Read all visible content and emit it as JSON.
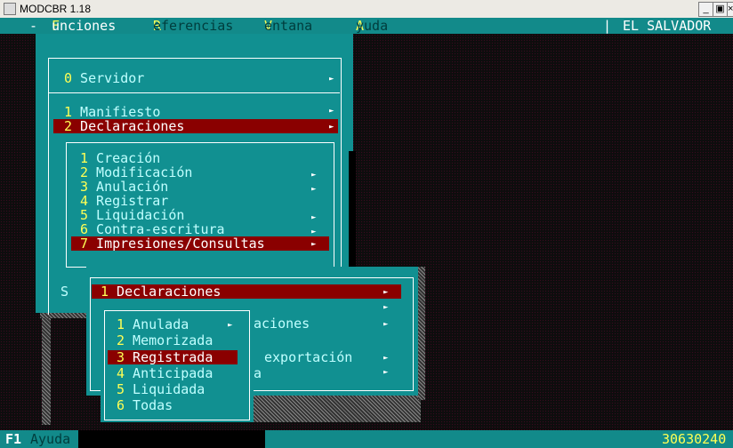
{
  "window": {
    "title": "MODCBR 1.18",
    "controls": [
      "_",
      "×"
    ]
  },
  "menubar": {
    "dash": "-",
    "items": [
      {
        "hot": "F",
        "rest": "unciones"
      },
      {
        "hot": "R",
        "rest": "eferencias"
      },
      {
        "hot": "V",
        "rest": "entana"
      },
      {
        "hot": "A",
        "rest": "yuda"
      }
    ],
    "country": "EL SALVADOR",
    "separator": "|"
  },
  "menu1": {
    "items": [
      {
        "num": "0",
        "label": " Servidor",
        "arrow": "►"
      },
      {
        "num": "1",
        "label": " Manifiesto",
        "arrow": "►"
      },
      {
        "num": "2",
        "label": " Declaraciones",
        "arrow": "►"
      }
    ],
    "partial_label": "S"
  },
  "menu2": {
    "items": [
      {
        "num": "1",
        "label": " Creación",
        "arrow": ""
      },
      {
        "num": "2",
        "label": " Modificación",
        "arrow": "►"
      },
      {
        "num": "3",
        "label": " Anulación",
        "arrow": "►"
      },
      {
        "num": "4",
        "label": " Registrar",
        "arrow": ""
      },
      {
        "num": "5",
        "label": " Liquidación",
        "arrow": "►"
      },
      {
        "num": "6",
        "label": " Contra-escritura",
        "arrow": "►"
      },
      {
        "num": "7",
        "label": " Impresiones/Consultas",
        "arrow": "►"
      }
    ]
  },
  "menu3": {
    "items": [
      {
        "num": "1",
        "label": " Declaraciones",
        "arrow": "►"
      },
      {
        "num": "",
        "label": "",
        "arrow": "►"
      },
      {
        "num": "",
        "label": "aciones",
        "arrow": "►"
      },
      {
        "num": "",
        "label": "",
        "arrow": ""
      },
      {
        "num": "",
        "label": "exportación",
        "arrow": "►"
      },
      {
        "num": "",
        "label": "a",
        "arrow": "►"
      }
    ]
  },
  "menu4": {
    "items": [
      {
        "num": "1",
        "label": " Anulada",
        "arrow": "►"
      },
      {
        "num": "2",
        "label": " Memorizada",
        "arrow": ""
      },
      {
        "num": "3",
        "label": " Registrada",
        "arrow": ""
      },
      {
        "num": "4",
        "label": " Anticipada",
        "arrow": ""
      },
      {
        "num": "5",
        "label": " Liquidada",
        "arrow": ""
      },
      {
        "num": "6",
        "label": " Todas",
        "arrow": ""
      }
    ]
  },
  "statusbar": {
    "key": "F1",
    "label": "Ayuda",
    "code": "30630240"
  },
  "colors": {
    "menubar": "#128a8a",
    "panel": "#119091",
    "highlight": "#8a0000",
    "hotkey": "#ffff55"
  }
}
